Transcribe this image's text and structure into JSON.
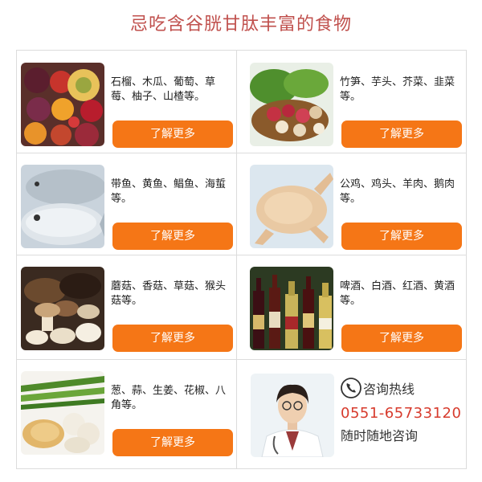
{
  "title": "忌吃含谷胱甘肽丰富的食物",
  "cells": [
    {
      "id": "fruits",
      "icon": "fruit-basket-image",
      "text": "石榴、木瓜、葡萄、草莓、柚子、山楂等。",
      "button": "了解更多"
    },
    {
      "id": "vegetables",
      "icon": "vegetables-basket-image",
      "text": "竹笋、芋头、芥菜、韭菜等。",
      "button": "了解更多"
    },
    {
      "id": "fish",
      "icon": "fish-image",
      "text": "带鱼、黄鱼、鲳鱼、海蜇等。",
      "button": "了解更多"
    },
    {
      "id": "meat",
      "icon": "chicken-image",
      "text": "公鸡、鸡头、羊肉、鹅肉等。",
      "button": "了解更多"
    },
    {
      "id": "mushrooms",
      "icon": "mushrooms-image",
      "text": "蘑菇、香菇、草菇、猴头菇等。",
      "button": "了解更多"
    },
    {
      "id": "alcohol",
      "icon": "alcohol-bottles-image",
      "text": "啤酒、白酒、红酒、黄酒等。",
      "button": "了解更多"
    },
    {
      "id": "spices",
      "icon": "spices-image",
      "text": "葱、蒜、生姜、花椒、八角等。",
      "button": "了解更多"
    }
  ],
  "contact": {
    "hotline_label": "咨询热线",
    "phone": "0551-65733120",
    "anytime": "随时随地咨询"
  },
  "colors": {
    "title": "#c0504d",
    "button": "#f57616",
    "phone": "#d73b2d"
  }
}
